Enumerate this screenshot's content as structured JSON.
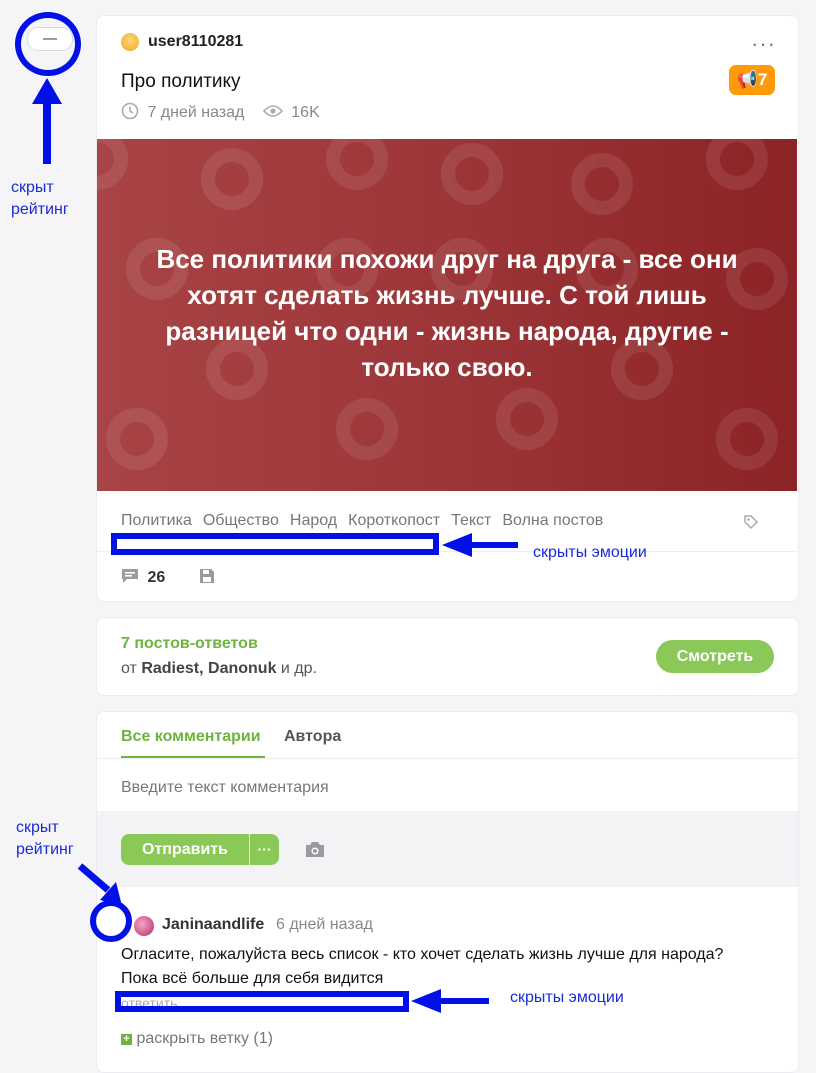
{
  "annotations": {
    "hidden_rating_1": "скрыт\nрейтинг",
    "hidden_rating_2": "скрыт\nрейтинг",
    "hidden_emotions_1": "скрыты эмоции",
    "hidden_emotions_2": "скрыты эмоции",
    "color": "#0010e6"
  },
  "post": {
    "author": "user8110281",
    "title": "Про политику",
    "rating_badge": "7",
    "time_ago": "7 дней назад",
    "views": "16K",
    "banner_text": "Все политики похожи друг на друга - все они хотят сделать жизнь лучше. С той лишь разницей что одни - жизнь народа, другие - только свою.",
    "tags": [
      "Политика",
      "Общество",
      "Народ",
      "Короткопост",
      "Текст",
      "Волна постов"
    ],
    "comments_count": "26",
    "colors": {
      "badge": "#ff9a0a",
      "banner": "#9b3436"
    }
  },
  "replies": {
    "title": "7 постов-ответов",
    "from_prefix": "от",
    "authors": "Radiest, Danonuk",
    "suffix": "и др.",
    "button": "Смотреть",
    "accent": "#6fb33f"
  },
  "comments": {
    "tabs": [
      "Все комментарии",
      "Автора"
    ],
    "input_placeholder": "Введите текст комментария",
    "send_button": "Отправить",
    "more_button": "···",
    "first": {
      "author": "Janinaandlife",
      "time_ago": "6 дней назад",
      "text_line1": "Огласите, пожалуйста весь список - кто хочет сделать жизнь лучше для народа?",
      "text_line2": "Пока всё больше для себя видится",
      "reply_link": "ответить",
      "expand": "раскрыть ветку (1)"
    }
  }
}
